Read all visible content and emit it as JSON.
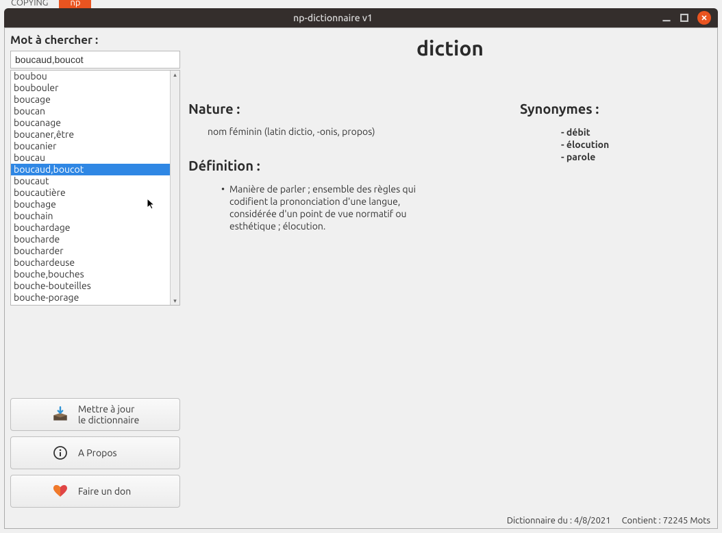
{
  "bg_tabs": {
    "inactive": "COPYING",
    "active": "np"
  },
  "window": {
    "title": "np-dictionnaire v1"
  },
  "search": {
    "label": "Mot à chercher :",
    "value": "boucaud,boucot"
  },
  "list": {
    "items": [
      "boubou",
      "boubouler",
      "boucage",
      "boucan",
      "boucanage",
      "boucaner,être",
      "boucanier",
      "boucau",
      "boucaud,boucot",
      "boucaut",
      "boucautière",
      "bouchage",
      "bouchain",
      "bouchardage",
      "boucharde",
      "boucharder",
      "bouchardeuse",
      "bouche,bouches",
      "bouche-bouteilles",
      "bouche-porage"
    ],
    "selected_index": 8
  },
  "entry": {
    "title": "diction",
    "nature_heading": "Nature :",
    "nature_text": "nom féminin (latin dictio, -onis, propos)",
    "definition_heading": "Définition :",
    "definitions": [
      "Manière de parler ; ensemble des règles qui codifient la prononciation d'une langue, considérée d'un point de vue normatif ou esthétique ; élocution."
    ],
    "synonyms_heading": "Synonymes :",
    "synonyms": [
      "- débit",
      "- élocution",
      "- parole"
    ]
  },
  "buttons": {
    "update_line1": "Mettre à jour",
    "update_line2": "le dictionnaire",
    "about": "A Propos",
    "donate": "Faire un don"
  },
  "status": {
    "date": "Dictionnaire du : 4/8/2021",
    "count": "Contient : 72245 Mots"
  }
}
